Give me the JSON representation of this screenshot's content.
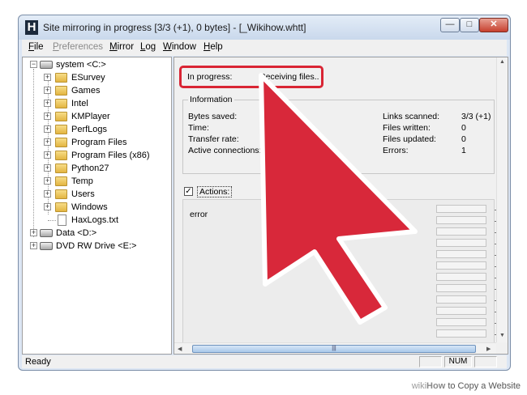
{
  "window": {
    "app_icon_letter": "H",
    "title": "Site mirroring in progress [3/3 (+1), 0 bytes] - [_Wikihow.whtt]",
    "min_glyph": "—",
    "max_glyph": "□",
    "close_glyph": "✕"
  },
  "menu": {
    "file": {
      "first": "F",
      "rest": "ile"
    },
    "preferences": {
      "first": "P",
      "rest": "references"
    },
    "mirror": {
      "first": "M",
      "rest": "irror"
    },
    "log": {
      "first": "L",
      "rest": "og"
    },
    "window": {
      "first": "W",
      "rest": "indow"
    },
    "help": {
      "first": "H",
      "rest": "elp"
    }
  },
  "tree": {
    "root": {
      "label": "system <C:>",
      "expander": "−"
    },
    "folders": [
      {
        "label": "ESurvey",
        "expander": "+"
      },
      {
        "label": "Games",
        "expander": "+"
      },
      {
        "label": "Intel",
        "expander": "+"
      },
      {
        "label": "KMPlayer",
        "expander": "+"
      },
      {
        "label": "PerfLogs",
        "expander": "+"
      },
      {
        "label": "Program Files",
        "expander": "+"
      },
      {
        "label": "Program Files (x86)",
        "expander": "+"
      },
      {
        "label": "Python27",
        "expander": "+"
      },
      {
        "label": "Temp",
        "expander": "+"
      },
      {
        "label": "Users",
        "expander": "+"
      },
      {
        "label": "Windows",
        "expander": "+"
      }
    ],
    "file": {
      "label": "HaxLogs.txt"
    },
    "drives": [
      {
        "label": "Data <D:>",
        "expander": "+"
      },
      {
        "label": "DVD RW Drive <E:>",
        "expander": "+"
      }
    ]
  },
  "progress": {
    "label": "In progress:",
    "value": "Receiving files.."
  },
  "information": {
    "title": "Information",
    "left": [
      {
        "label": "Bytes saved:"
      },
      {
        "label": "Time:"
      },
      {
        "label": "Transfer rate:"
      },
      {
        "label": "Active connections:"
      }
    ],
    "right": [
      {
        "label": "Links scanned:",
        "value": "3/3 (+1)"
      },
      {
        "label": "Files written:",
        "value": "0"
      },
      {
        "label": "Files updated:",
        "value": "0"
      },
      {
        "label": "Errors:",
        "value": "1"
      }
    ]
  },
  "actions": {
    "label": "Actions:",
    "check": "✓",
    "first_entry": "error"
  },
  "scroll": {
    "hthumb_grip": "|||",
    "left_arrow": "◀",
    "right_arrow": "▶",
    "up_arrow": "▲",
    "down_arrow": "▼"
  },
  "status": {
    "text": "Ready",
    "num": "NUM"
  },
  "watermark": {
    "wiki": "wiki",
    "how": "How",
    "rest": " to Copy a Website"
  },
  "colors": {
    "highlight": "#d92534",
    "arrow_fill": "#d8283a"
  }
}
